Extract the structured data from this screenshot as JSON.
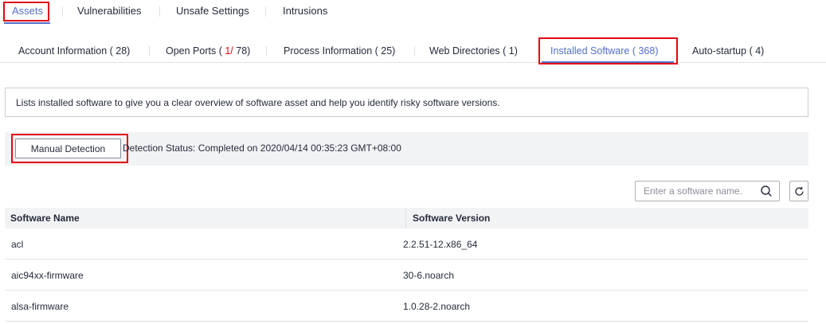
{
  "top_tabs": [
    {
      "label": "Assets",
      "active": true
    },
    {
      "label": "Vulnerabilities"
    },
    {
      "label": "Unsafe Settings"
    },
    {
      "label": "Intrusions"
    }
  ],
  "sub_tabs": [
    {
      "label": "Account Information ( 28)"
    },
    {
      "label_prefix": "Open Ports ( ",
      "label_accent": "1/",
      "label_suffix": " 78)"
    },
    {
      "label": "Process Information ( 25)"
    },
    {
      "label": "Web Directories ( 1)"
    },
    {
      "label": "Installed Software ( 368)",
      "active": true
    },
    {
      "label": "Auto-startup ( 4)"
    }
  ],
  "info": {
    "text": "Lists installed software to give you a clear overview of software asset and help you identify risky software versions."
  },
  "detection": {
    "button_label": "Manual Detection",
    "status": "Detection Status: Completed on 2020/04/14 00:35:23 GMT+08:00"
  },
  "search": {
    "placeholder": "Enter a software name."
  },
  "table": {
    "columns": [
      "Software Name",
      "Software Version"
    ],
    "rows": [
      [
        "acl",
        "2.2.51-12.x86_64"
      ],
      [
        "aic94xx-firmware",
        "30-6.noarch"
      ],
      [
        "alsa-firmware",
        "1.0.28-2.noarch"
      ]
    ]
  },
  "colors": {
    "accent": "#526ecc",
    "highlight": "#e30613",
    "text": "#252b3a",
    "bar_bg": "#f2f3f5"
  }
}
